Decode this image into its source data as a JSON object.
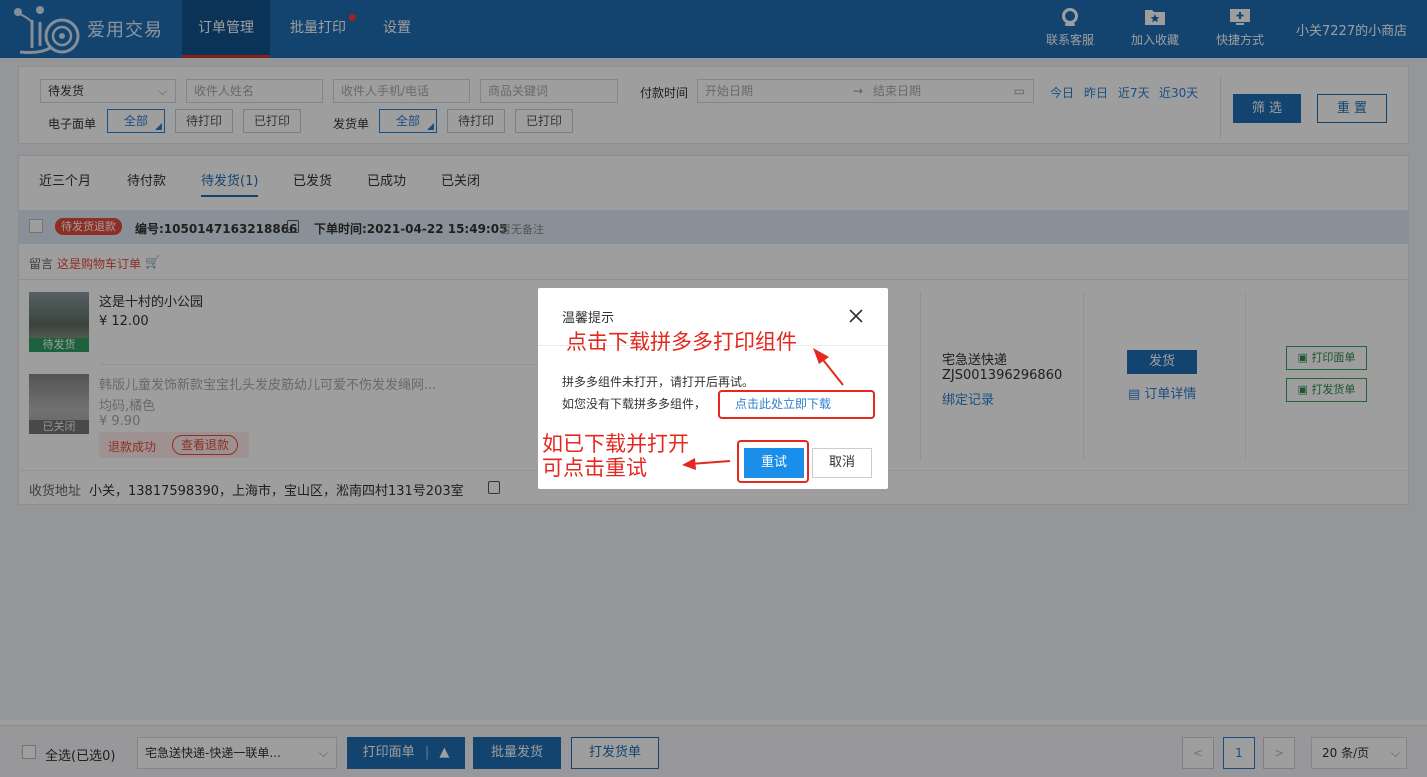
{
  "header": {
    "brand": "爱用交易",
    "nav": [
      "订单管理",
      "批量打印",
      "设置"
    ],
    "actions": [
      {
        "label": "联系客服",
        "icon": "headset-icon"
      },
      {
        "label": "加入收藏",
        "icon": "folder-star-icon"
      },
      {
        "label": "快捷方式",
        "icon": "monitor-plus-icon"
      }
    ],
    "shop": "小关7227的小商店"
  },
  "filters": {
    "status_value": "待发货",
    "name_placeholder": "收件人姓名",
    "phone_placeholder": "收件人手机/电话",
    "keyword_placeholder": "商品关键词",
    "pay_time_label": "付款时间",
    "start_placeholder": "开始日期",
    "end_placeholder": "结束日期",
    "quick_dates": [
      "今日",
      "昨日",
      "近7天",
      "近30天"
    ],
    "esheet_label": "电子面单",
    "ship_label": "发货单",
    "opts": [
      "全部",
      "待打印",
      "已打印"
    ],
    "filter_btn": "筛 选",
    "reset_btn": "重 置"
  },
  "tabs": [
    "近三个月",
    "待付款",
    "待发货(1)",
    "已发货",
    "已成功",
    "已关闭"
  ],
  "order": {
    "status_tag": "待发货退款",
    "number": "编号:1050147163218866",
    "time": "下单时间:2021-04-22 15:49:05",
    "memo": "暂无备注",
    "message_label": "留言",
    "message": "这是购物车订单",
    "items": [
      {
        "title": "这是十村的小公园",
        "price": "¥ 12.00",
        "tag": "待发货"
      },
      {
        "title": "韩版儿童发饰新款宝宝扎头发皮筋幼儿可爱不伤发发绳网...",
        "sku": "均码,橘色",
        "price": "¥ 9.90",
        "tag": "已关闭",
        "refund": "退款成功",
        "view_refund": "查看退款"
      }
    ],
    "express": "宅急送快递",
    "tracking": "ZJS001396296860",
    "bind_record": "绑定记录",
    "ship_btn": "发货",
    "detail": "订单详情",
    "print_sheet": "打印面单",
    "print_ship": "打发货单",
    "address_label": "收货地址",
    "address": "小关，13817598390，上海市，宝山区，淞南四村131号203室"
  },
  "dialog": {
    "title": "温馨提示",
    "line1": "拼多多组件未打开，请打开后再试。",
    "line2": "如您没有下载拼多多组件，",
    "download_link": "点击此处立即下载",
    "retry": "重试",
    "cancel": "取消",
    "annotation_top": "点击下载拼多多打印组件",
    "annotation_left_1": "如已下载并打开",
    "annotation_left_2": "可点击重试"
  },
  "bottom": {
    "select_all": "全选(已选0)",
    "template": "宅急送快递-快递一联单...",
    "print_sheet": "打印面单",
    "batch_ship": "批量发货",
    "print_ship": "打发货单",
    "page": "1",
    "page_size": "20 条/页"
  }
}
